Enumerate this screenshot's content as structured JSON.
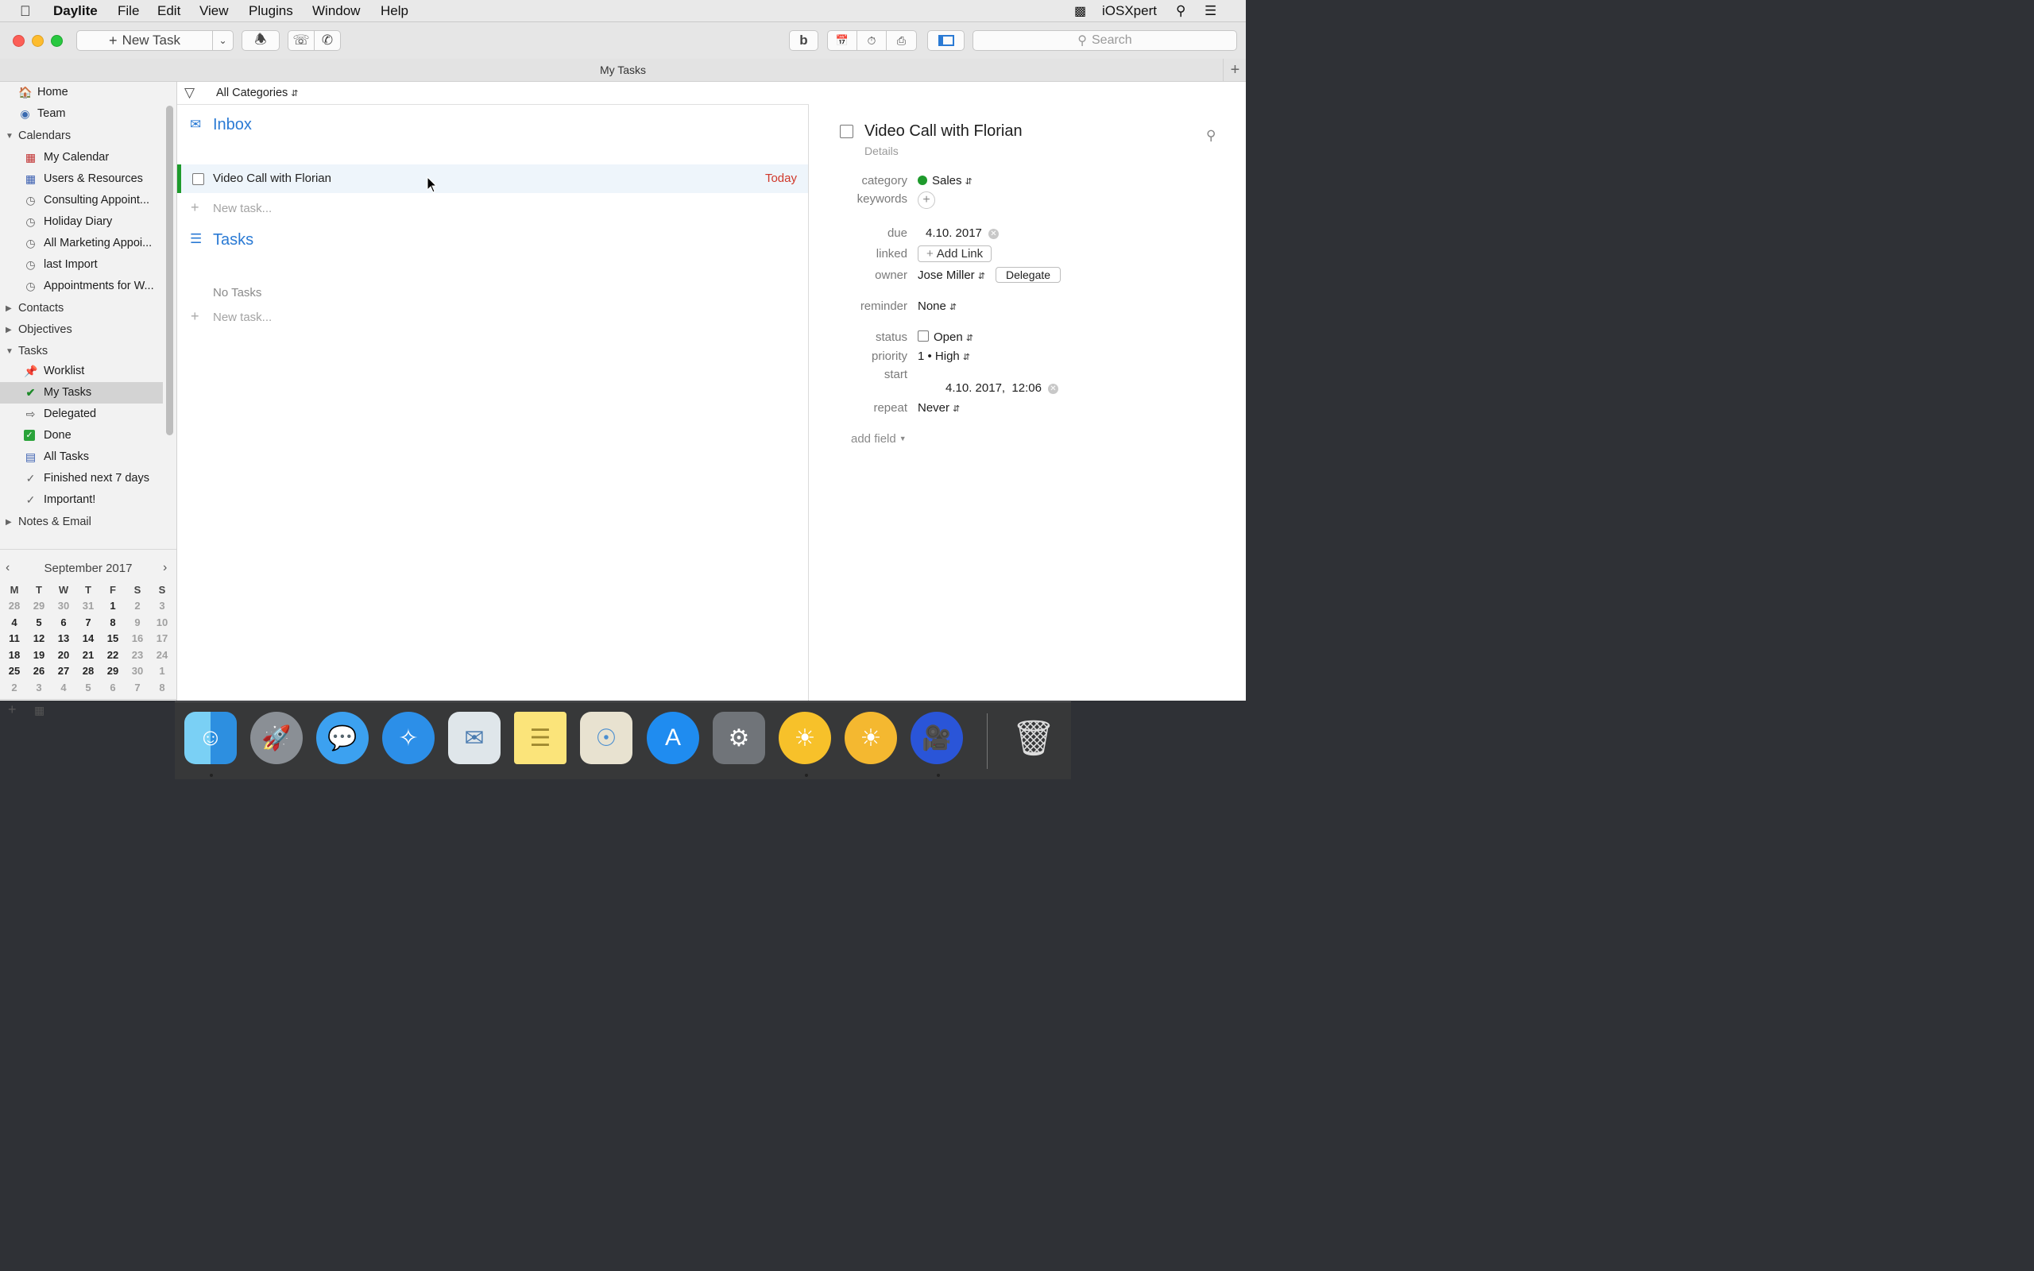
{
  "menubar": {
    "app_name": "Daylite",
    "items": [
      "File",
      "Edit",
      "View",
      "Plugins",
      "Window",
      "Help"
    ],
    "user": "iOSXpert"
  },
  "toolbar": {
    "new_task": "New Task",
    "search_placeholder": "Search"
  },
  "window_title": "My Tasks",
  "sidebar": {
    "home": "Home",
    "team": "Team",
    "calendars_header": "Calendars",
    "calendars": [
      "My Calendar",
      "Users & Resources",
      "Consulting Appoint...",
      "Holiday Diary",
      "All Marketing Appoi...",
      "last Import",
      "Appointments for W..."
    ],
    "contacts_header": "Contacts",
    "objectives_header": "Objectives",
    "tasks_header": "Tasks",
    "tasks": [
      "Worklist",
      "My Tasks",
      "Delegated",
      "Done",
      "All Tasks",
      "Finished next 7 days",
      "Important!"
    ],
    "notes_header": "Notes & Email"
  },
  "mini_calendar": {
    "title": "September 2017",
    "weekdays": [
      "M",
      "T",
      "W",
      "T",
      "F",
      "S",
      "S"
    ],
    "weeks": [
      [
        "28",
        "29",
        "30",
        "31",
        "1",
        "2",
        "3"
      ],
      [
        "4",
        "5",
        "6",
        "7",
        "8",
        "9",
        "10"
      ],
      [
        "11",
        "12",
        "13",
        "14",
        "15",
        "16",
        "17"
      ],
      [
        "18",
        "19",
        "20",
        "21",
        "22",
        "23",
        "24"
      ],
      [
        "25",
        "26",
        "27",
        "28",
        "29",
        "30",
        "1"
      ],
      [
        "2",
        "3",
        "4",
        "5",
        "6",
        "7",
        "8"
      ]
    ]
  },
  "list": {
    "filter": "All Categories",
    "inbox_title": "Inbox",
    "inbox_task": "Video Call with Florian",
    "inbox_task_due": "Today",
    "new_task": "New task...",
    "tasks_title": "Tasks",
    "no_tasks": "No Tasks"
  },
  "detail": {
    "title": "Video Call with Florian",
    "subtitle": "Details",
    "labels": {
      "category": "category",
      "keywords": "keywords",
      "due": "due",
      "linked": "linked",
      "owner": "owner",
      "reminder": "reminder",
      "status": "status",
      "priority": "priority",
      "start": "start",
      "repeat": "repeat"
    },
    "category": "Sales",
    "category_color": "#1e9a2c",
    "due": "4.10. 2017",
    "add_link": "Add Link",
    "owner": "Jose Miller",
    "delegate": "Delegate",
    "reminder": "None",
    "status": "Open",
    "priority": "1 • High",
    "start": "4.10. 2017,  12:06",
    "repeat": "Never",
    "add_field": "add field"
  },
  "dock": {
    "apps": [
      "finder-icon",
      "launchpad-icon",
      "messages-icon",
      "safari-icon",
      "mail-icon",
      "notes-icon",
      "maps-icon",
      "app-store-icon",
      "system-preferences-icon",
      "daylite-icon",
      "daylite-server-icon",
      "clips-icon",
      "trash-icon"
    ]
  }
}
